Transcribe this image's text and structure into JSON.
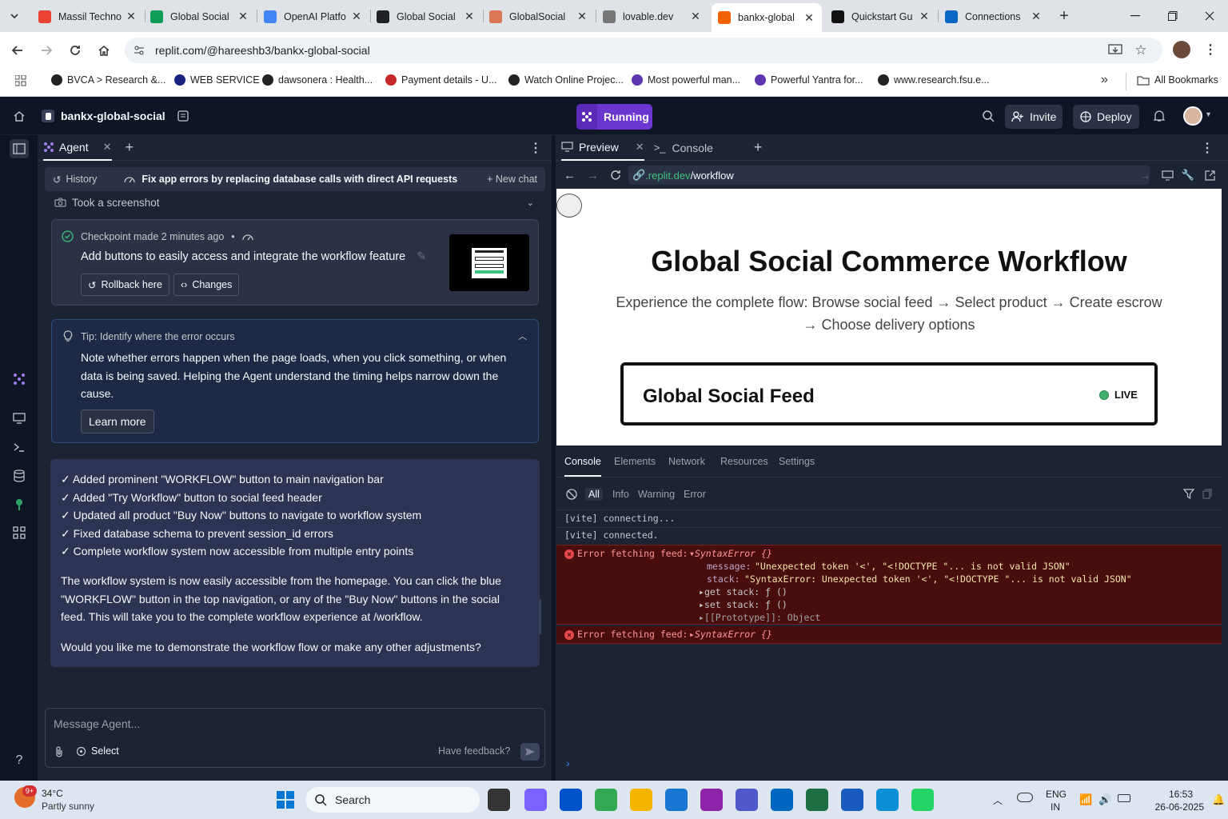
{
  "browser": {
    "tabs": [
      {
        "title": "Massil Techno",
        "favicon_color": "#ea4335"
      },
      {
        "title": "Global Social",
        "favicon_color": "#0f9d58"
      },
      {
        "title": "OpenAI Platfo",
        "favicon_color": "#4285f4"
      },
      {
        "title": "Global Social",
        "favicon_color": "#202124"
      },
      {
        "title": "GlobalSocial",
        "favicon_color": "#d97757"
      },
      {
        "title": "lovable.dev",
        "favicon_color": "#777"
      },
      {
        "title": "bankx-global",
        "favicon_color": "#f26207",
        "active": true
      },
      {
        "title": "Quickstart Gu",
        "favicon_color": "#111"
      },
      {
        "title": "Connections",
        "favicon_color": "#0a66c2"
      }
    ],
    "url": "replit.com/@hareeshb3/bankx-global-social",
    "bookmarks": [
      {
        "label": "BVCA > Research &...",
        "color": "#222"
      },
      {
        "label": "WEB SERVICE",
        "color": "#1a237e"
      },
      {
        "label": "dawsonera : Health...",
        "color": "#222"
      },
      {
        "label": "Payment details - U...",
        "color": "#c62828"
      },
      {
        "label": "Watch Online Projec...",
        "color": "#222"
      },
      {
        "label": "Most powerful man...",
        "color": "#5e35b1"
      },
      {
        "label": "Powerful Yantra for...",
        "color": "#5e35b1"
      },
      {
        "label": "www.research.fsu.e...",
        "color": "#222"
      }
    ],
    "all_bookmarks": "All Bookmarks"
  },
  "replit": {
    "project_name": "bankx-global-social",
    "run_status": "Running",
    "invite": "Invite",
    "deploy": "Deploy"
  },
  "agent": {
    "tab_label": "Agent",
    "history": "History",
    "chat_title": "Fix app errors by replacing database calls with direct API requests",
    "new_chat": "+ New chat",
    "screenshot_label": "Took a screenshot",
    "checkpoint_meta": "Checkpoint made 2 minutes ago",
    "checkpoint_desc": "Add buttons to easily access and integrate the workflow feature",
    "rollback": "Rollback here",
    "changes": "Changes",
    "tip_title": "Tip: Identify where the error occurs",
    "tip_body": "Note whether errors happen when the page loads, when you click something, or when data is being saved. Helping the Agent understand the timing helps narrow down the cause.",
    "learn_more": "Learn more",
    "checklist": [
      "✓ Added prominent \"WORKFLOW\" button to main navigation bar",
      "✓ Added \"Try Workflow\" button to social feed header",
      "✓ Updated all product \"Buy Now\" buttons to navigate to workflow system",
      "✓ Fixed database schema to prevent session_id errors",
      "✓ Complete workflow system now accessible from multiple entry points"
    ],
    "paragraph1": "The workflow system is now easily accessible from the homepage. You can click the blue \"WORKFLOW\" button in the top navigation, or any of the \"Buy Now\" buttons in the social feed. This will take you to the complete workflow experience at /workflow.",
    "paragraph2": "Would you like me to demonstrate the workflow flow or make any other adjustments?",
    "input_placeholder": "Message Agent...",
    "select_label": "Select",
    "feedback": "Have feedback?"
  },
  "preview": {
    "tab_preview": "Preview",
    "tab_console": "Console",
    "url_domain": ".replit.dev",
    "url_path": "/workflow",
    "page_title": "Global Social Commerce Workflow",
    "page_subtitle_1": "Experience the complete flow: Browse social feed → Select product → Create escrow",
    "page_subtitle_2": "→ Choose delivery options",
    "feed_title": "Global Social Feed",
    "live_badge": "LIVE"
  },
  "devtools": {
    "tabs": [
      "Console",
      "Elements",
      "Network",
      "Resources",
      "Settings"
    ],
    "filters": [
      "All",
      "Info",
      "Warning",
      "Error"
    ],
    "log1": "[vite] connecting...",
    "log2": "[vite] connected.",
    "err_label": "Error fetching feed:",
    "err_obj": "SyntaxError {}",
    "msg_key": "message:",
    "msg_val": "\"Unexpected token '<', \"<!DOCTYPE \"... is not valid JSON\"",
    "stack_key": "stack:",
    "stack_val": "\"SyntaxError: Unexpected token '<', \"<!DOCTYPE \"... is not valid JSON\"",
    "get_stack": "get stack: ƒ ()",
    "set_stack": "set stack: ƒ ()",
    "proto": "[[Prototype]]: Object"
  },
  "taskbar": {
    "weather_temp": "34°C",
    "weather_desc": "Partly sunny",
    "weather_badge": "9+",
    "search": "Search",
    "lang1": "ENG",
    "lang2": "IN",
    "time": "16:53",
    "date": "26-06-2025"
  }
}
